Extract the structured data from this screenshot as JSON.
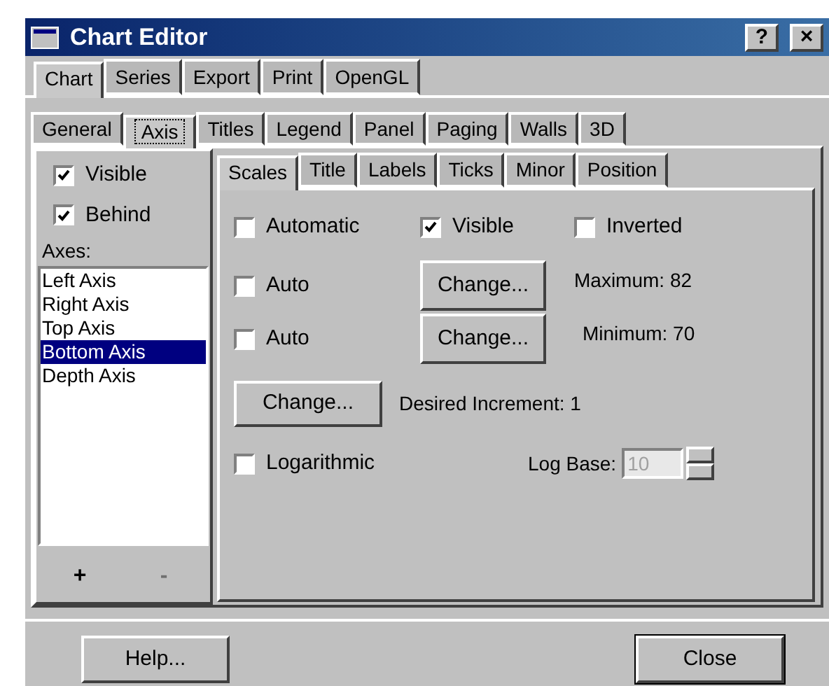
{
  "window": {
    "title": "Chart Editor",
    "help_button": "?",
    "close_button": "×"
  },
  "main_tabs": [
    {
      "label": "Chart",
      "selected": true
    },
    {
      "label": "Series",
      "selected": false
    },
    {
      "label": "Export",
      "selected": false
    },
    {
      "label": "Print",
      "selected": false
    },
    {
      "label": "OpenGL",
      "selected": false
    }
  ],
  "sub_tabs": [
    {
      "label": "General",
      "selected": false
    },
    {
      "label": "Axis",
      "selected": true
    },
    {
      "label": "Titles",
      "selected": false
    },
    {
      "label": "Legend",
      "selected": false
    },
    {
      "label": "Panel",
      "selected": false
    },
    {
      "label": "Paging",
      "selected": false
    },
    {
      "label": "Walls",
      "selected": false
    },
    {
      "label": "3D",
      "selected": false
    }
  ],
  "axis_panel": {
    "checkboxes": [
      {
        "label": "Visible",
        "checked": true
      },
      {
        "label": "Behind",
        "checked": true
      }
    ],
    "axes_label": "Axes:",
    "axes": [
      {
        "label": "Left Axis",
        "selected": false
      },
      {
        "label": "Right Axis",
        "selected": false
      },
      {
        "label": "Top Axis",
        "selected": false
      },
      {
        "label": "Bottom Axis",
        "selected": true
      },
      {
        "label": "Depth Axis",
        "selected": false
      }
    ],
    "add_button": {
      "label": "+",
      "disabled": false
    },
    "remove_button": {
      "label": "-",
      "disabled": true
    }
  },
  "axis_tabs": [
    {
      "label": "Scales",
      "selected": true
    },
    {
      "label": "Title",
      "selected": false
    },
    {
      "label": "Labels",
      "selected": false
    },
    {
      "label": "Ticks",
      "selected": false
    },
    {
      "label": "Minor",
      "selected": false
    },
    {
      "label": "Position",
      "selected": false
    }
  ],
  "scales": {
    "automatic": {
      "label": "Automatic",
      "checked": false
    },
    "visible": {
      "label": "Visible",
      "checked": true
    },
    "inverted": {
      "label": "Inverted",
      "checked": false
    },
    "maximum": {
      "auto": {
        "label": "Auto",
        "checked": false
      },
      "button": "Change...",
      "reading": "Maximum: 82"
    },
    "minimum": {
      "auto": {
        "label": "Auto",
        "checked": false
      },
      "button": "Change...",
      "reading": "Minimum: 70"
    },
    "increment": {
      "button": "Change...",
      "reading": "Desired Increment: 1"
    },
    "logarithmic": {
      "label": "Logarithmic",
      "checked": false
    },
    "log_base": {
      "label": "Log Base:",
      "value": "10",
      "disabled": true
    }
  },
  "footer": {
    "help_button": "Help...",
    "close_button": "Close"
  }
}
